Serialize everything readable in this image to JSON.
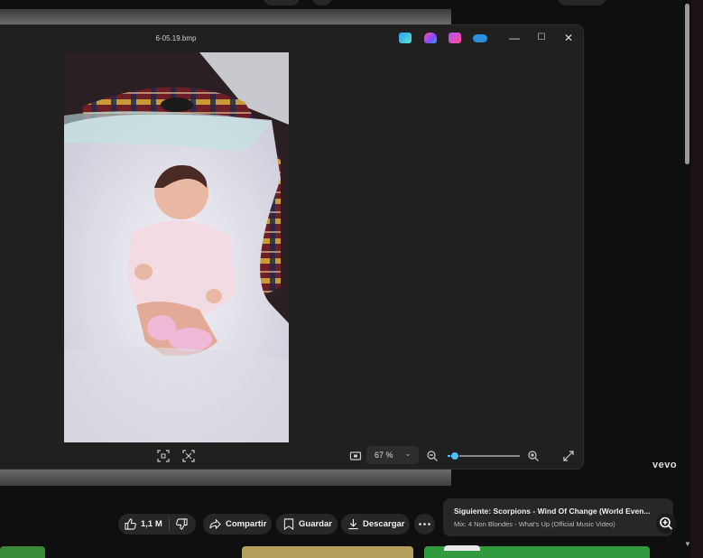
{
  "viewer": {
    "title": "6-05.19.bmp",
    "zoom_value": "67 %",
    "zoom_fraction": 0.1,
    "controls": {
      "minimize": "—",
      "maximize": "☐",
      "close": "✕"
    }
  },
  "youtube": {
    "like_count": "1,1 M",
    "share_label": "Compartir",
    "save_label": "Guardar",
    "download_label": "Descargar",
    "next_label": "Siguiente:",
    "next_title": "Scorpions - Wind Of Change (World Even...",
    "next_mix": "Mix: 4 Non Blondes - What's Up (Official Music Video)",
    "brand": "vevo"
  },
  "colors": {
    "accent": "#4cc2ff",
    "background": "#0f0f0f",
    "viewer_bg": "#202020"
  }
}
